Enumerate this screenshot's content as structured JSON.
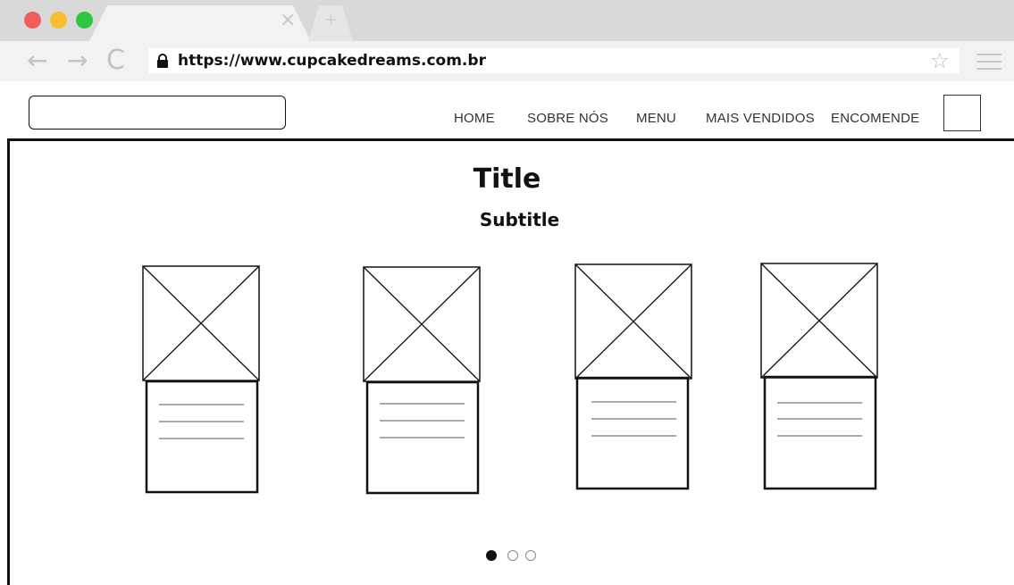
{
  "browser": {
    "traffic_lights": [
      "#f15d5b",
      "#fbbd2e",
      "#2fc541"
    ],
    "tab_close_icon": "close-icon",
    "new_tab_icon": "plus-icon",
    "back_glyph": "←",
    "forward_glyph": "→",
    "reload_glyph": "C",
    "url": "https://www.cupcakedreams.com.br",
    "star_glyph": "☆"
  },
  "header": {
    "nav": [
      "HOME",
      "SOBRE NÓS",
      "MENU",
      "MAIS VENDIDOS",
      "ENCOMENDE"
    ]
  },
  "main": {
    "title": "Title",
    "subtitle": "Subtitle",
    "cards": [
      {
        "name": "product-card-1"
      },
      {
        "name": "product-card-2"
      },
      {
        "name": "product-card-3"
      },
      {
        "name": "product-card-4"
      }
    ]
  },
  "pagination": {
    "pages": 3,
    "active": 1
  }
}
